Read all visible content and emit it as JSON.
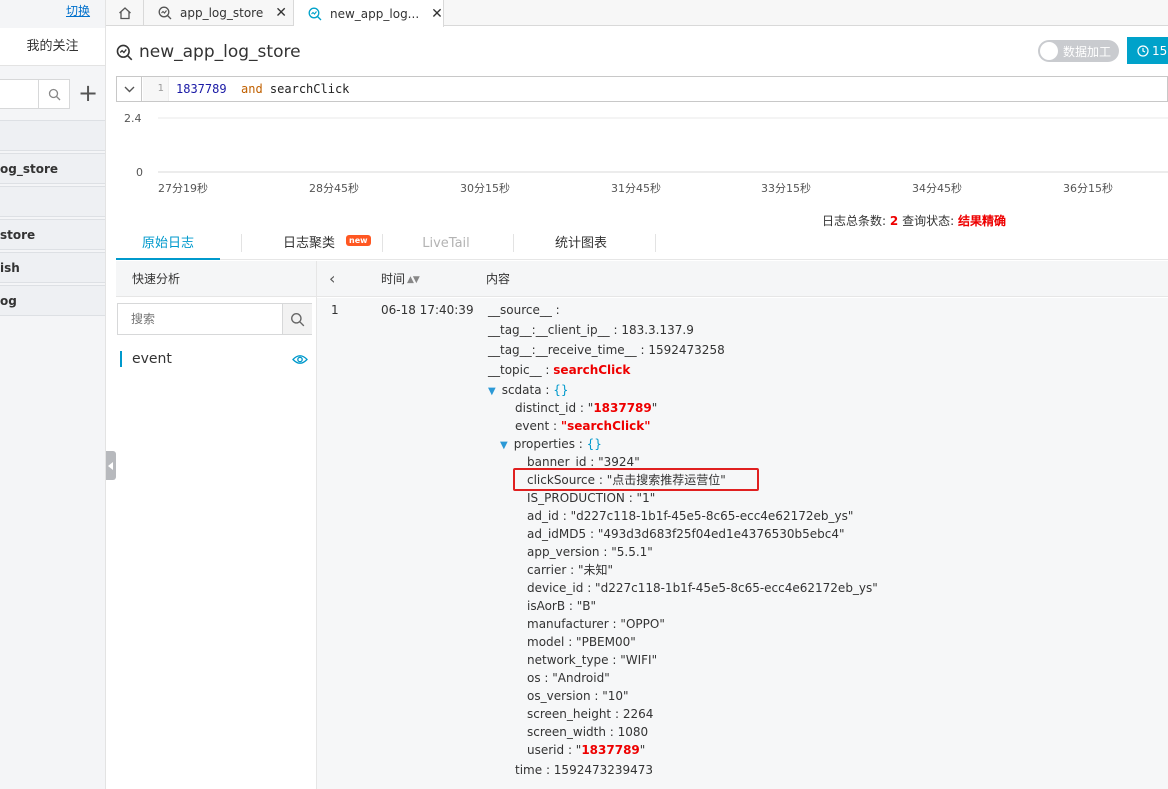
{
  "nav": {
    "switch_label": "切换",
    "my_follow": "我的关注",
    "search_icon": "search-icon",
    "add_icon": "plus-icon",
    "add_label": "+",
    "items": [
      {
        "label": ""
      },
      {
        "label": "og_store"
      },
      {
        "label": ""
      },
      {
        "label": "store"
      },
      {
        "label": "ish"
      },
      {
        "label": "og"
      }
    ]
  },
  "tabs": {
    "home_icon": "home-icon",
    "items": [
      {
        "label": "app_log_store",
        "icon": "search-log-icon",
        "active": false
      },
      {
        "label": "new_app_log...",
        "icon": "search-log-icon",
        "active": true
      }
    ],
    "close_glyph": "✕"
  },
  "header": {
    "title": "new_app_log_store",
    "toggle_label": "数据加工",
    "time_label": "15",
    "accent": "#00a2ca"
  },
  "query": {
    "line_number": "1",
    "tokens": [
      {
        "text": "1837789",
        "kind": "num"
      },
      {
        "text": "  and",
        "kind": "kw"
      },
      {
        "text": " searchClick",
        "kind": "plain"
      }
    ]
  },
  "histogram": {
    "y_ticks": [
      "2.4",
      "0"
    ],
    "x_ticks": [
      "27分19秒",
      "28分45秒",
      "30分15秒",
      "31分45秒",
      "33分15秒",
      "34分45秒",
      "36分15秒"
    ],
    "summary": {
      "total_label": "日志总条数:",
      "total_value": "2",
      "status_label": "查询状态:",
      "status_value": "结果精确"
    }
  },
  "result_tabs": [
    {
      "label": "原始日志",
      "state": "active"
    },
    {
      "label": "日志聚类",
      "state": "normal",
      "badge": "new"
    },
    {
      "label": "LiveTail",
      "state": "disabled"
    },
    {
      "label": "统计图表",
      "state": "normal"
    }
  ],
  "quick_analysis": {
    "title": "快速分析",
    "search_placeholder": "搜索",
    "fields": [
      {
        "name": "event",
        "icon": "eye-icon"
      }
    ]
  },
  "log_table": {
    "prev_glyph": "‹",
    "columns": {
      "time": "时间",
      "content": "内容"
    },
    "rows": [
      {
        "index": "1",
        "time": "06-18 17:40:39",
        "fields": [
          {
            "key": "__source__",
            "value": ""
          },
          {
            "key": "__tag__:__client_ip__",
            "value": "183.3.137.9"
          },
          {
            "key": "__tag__:__receive_time__",
            "value": "1592473258"
          },
          {
            "key": "__topic__",
            "value": "searchClick"
          },
          {
            "key": "scdata",
            "value": "{}"
          },
          {
            "key": "distinct_id",
            "value": "1837789"
          },
          {
            "key": "event",
            "value": "searchClick"
          },
          {
            "key": "properties",
            "value": "{}"
          },
          {
            "key": "banner_id",
            "value": "3924"
          },
          {
            "key": "clickSource",
            "value": "点击搜索推荐运营位"
          },
          {
            "key": "IS_PRODUCTION",
            "value": "1"
          },
          {
            "key": "ad_id",
            "value": "d227c118-1b1f-45e5-8c65-ecc4e62172eb_ys"
          },
          {
            "key": "ad_idMD5",
            "value": "493d3d683f25f04ed1e4376530b5ebc4"
          },
          {
            "key": "app_version",
            "value": "5.5.1"
          },
          {
            "key": "carrier",
            "value": "未知"
          },
          {
            "key": "device_id",
            "value": "d227c118-1b1f-45e5-8c65-ecc4e62172eb_ys"
          },
          {
            "key": "isAorB",
            "value": "B"
          },
          {
            "key": "manufacturer",
            "value": "OPPO"
          },
          {
            "key": "model",
            "value": "PBEM00"
          },
          {
            "key": "network_type",
            "value": "WIFI"
          },
          {
            "key": "os",
            "value": "Android"
          },
          {
            "key": "os_version",
            "value": "10"
          },
          {
            "key": "screen_height",
            "value": "2264"
          },
          {
            "key": "screen_width",
            "value": "1080"
          },
          {
            "key": "userid",
            "value": "1837789"
          },
          {
            "key": "time",
            "value": "1592473239473"
          }
        ]
      }
    ]
  }
}
